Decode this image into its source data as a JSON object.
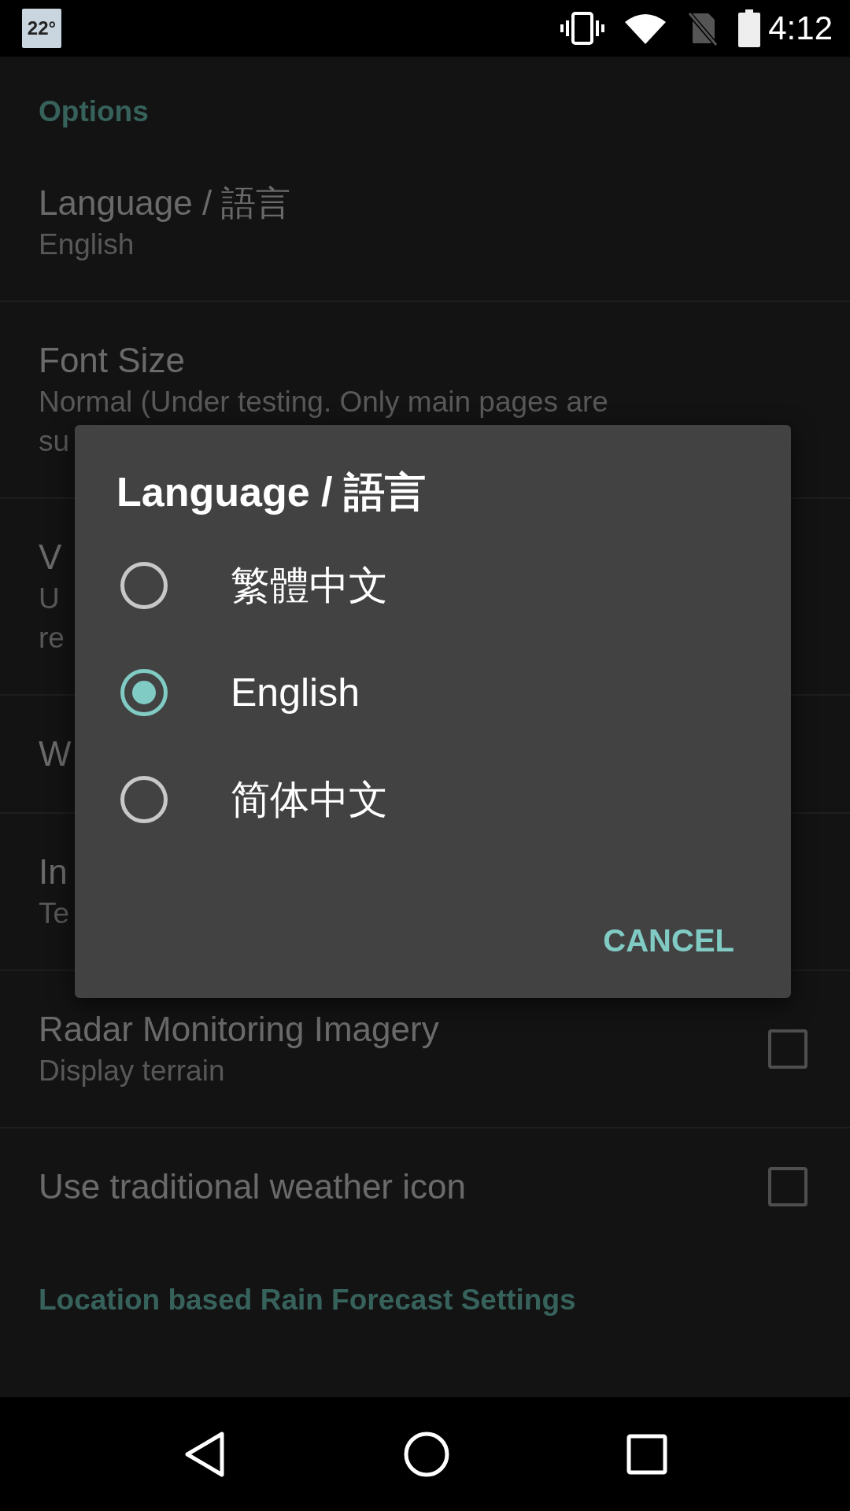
{
  "status_bar": {
    "weather_badge": "22°",
    "time": "4:12"
  },
  "settings": [
    {
      "kind": "header",
      "title": "Options"
    },
    {
      "kind": "item",
      "title": "Language / 語言",
      "summary": [
        "English"
      ]
    },
    {
      "kind": "item",
      "title": "Font Size",
      "summary": [
        "Normal (Under testing. Only main pages are",
        "su"
      ]
    },
    {
      "kind": "item",
      "title": "V",
      "summary": [
        "U",
        "re"
      ]
    },
    {
      "kind": "item",
      "title": "W"
    },
    {
      "kind": "item",
      "title": "In",
      "summary": [
        "Te"
      ]
    },
    {
      "kind": "check",
      "title": "Radar Monitoring Imagery",
      "summary": [
        "Display terrain"
      ],
      "checked": false
    },
    {
      "kind": "check",
      "title": "Use traditional weather icon",
      "checked": false
    },
    {
      "kind": "header",
      "title": "Location based Rain Forecast Settings"
    }
  ],
  "dialog": {
    "title": "Language / 語言",
    "options": [
      {
        "label": "繁體中文",
        "selected": false
      },
      {
        "label": "English",
        "selected": true
      },
      {
        "label": "简体中文",
        "selected": false
      }
    ],
    "buttons": [
      "CANCEL"
    ]
  }
}
